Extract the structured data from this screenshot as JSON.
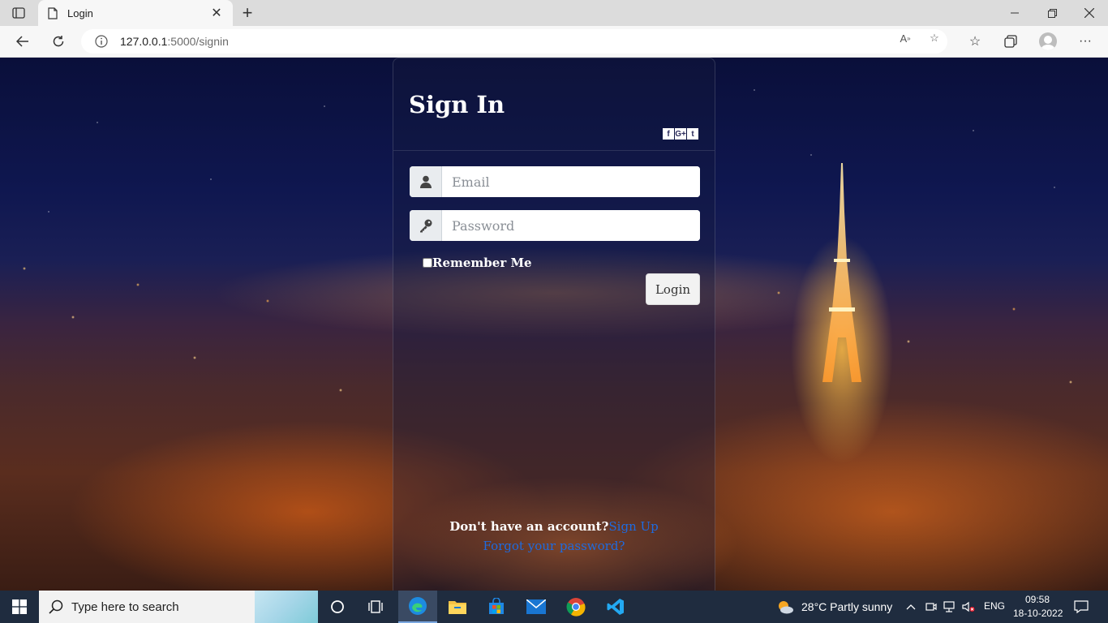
{
  "browser": {
    "tab_title": "Login",
    "url_host": "127.0.0.1",
    "url_path": ":5000/signin"
  },
  "page": {
    "title": "Sign In",
    "email_placeholder": "Email",
    "password_placeholder": "Password",
    "remember_label": "Remember Me",
    "login_label": "Login",
    "no_account_text": "Don't have an account?",
    "signup_link": "Sign Up",
    "forgot_link": "Forgot your password?",
    "social": [
      "f",
      "G+",
      "t"
    ],
    "link_color": "#1e6be0"
  },
  "taskbar": {
    "search_placeholder": "Type here to search",
    "weather": "28°C  Partly sunny",
    "language": "ENG",
    "time": "09:58",
    "date": "18-10-2022"
  }
}
